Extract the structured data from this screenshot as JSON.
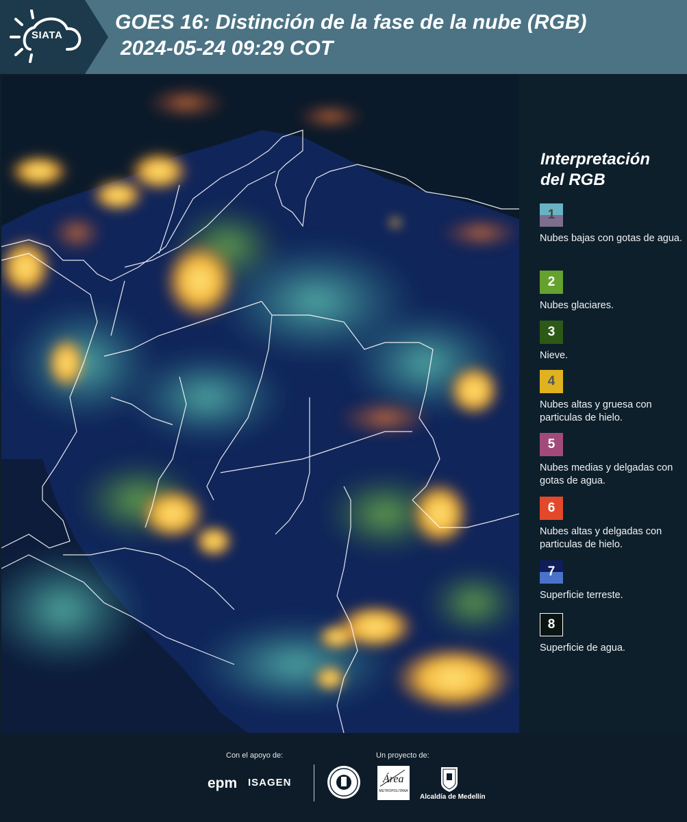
{
  "header": {
    "logo_text": "SIATA",
    "title_line1": "GOES 16: Distinción de la fase de la nube (RGB)",
    "title_line2": "2024-05-24 09:29 COT"
  },
  "legend": {
    "title_line1": "Interpretación",
    "title_line2": "del RGB",
    "items": [
      {
        "number": "1",
        "label": "Nubes bajas con gotas de agua.",
        "color_top": "#67b3c3",
        "color_bottom": "#7d6e8f"
      },
      {
        "number": "2",
        "label": "Nubes glaciares.",
        "color": "#64a12e"
      },
      {
        "number": "3",
        "label": "Nieve.",
        "color": "#2c5a16"
      },
      {
        "number": "4",
        "label": "Nubes altas y gruesa con particulas de hielo.",
        "color": "#e0b21f"
      },
      {
        "number": "5",
        "label": "Nubes medias y delgadas con gotas de agua.",
        "color": "#a24b7a"
      },
      {
        "number": "6",
        "label": "Nubes altas y delgadas con particulas de hielo.",
        "color": "#e4482a"
      },
      {
        "number": "7",
        "label": "Superficie terreste.",
        "color_top": "#0f1d5a",
        "color_bottom": "#4a72c8"
      },
      {
        "number": "8",
        "label": "Superficie de agua.",
        "color": "#0a1410"
      }
    ]
  },
  "footer": {
    "support_label": "Con el apoyo de:",
    "project_label": "Un proyecto de:",
    "epm": "epm",
    "isagen": "ISAGEN",
    "amva_name": "Área",
    "amva_sub": "METROPOLITANA",
    "medellin": "Alcaldía de Medellín"
  }
}
